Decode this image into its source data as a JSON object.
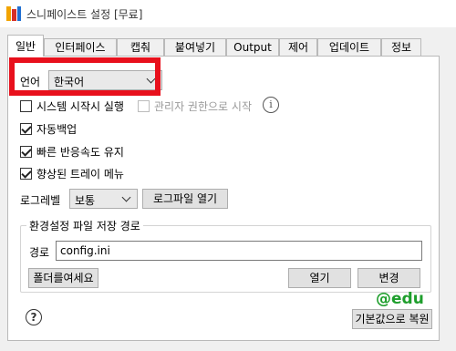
{
  "window": {
    "title": "스니페이스트 설정 [무료]"
  },
  "tabs": [
    "일반",
    "인터페이스",
    "캡춰",
    "붙여넣기",
    "Output",
    "제어",
    "업데이트",
    "정보"
  ],
  "language": {
    "label": "언어",
    "value": "한국어"
  },
  "options": {
    "startup": "시스템 시작시 실행",
    "admin": "관리자 권한으로 시작",
    "autobackup": "자동백업",
    "fast_response": "빠른 반응속도 유지",
    "tray_menu": "향상된 트레이 메뉴"
  },
  "option_states": {
    "startup": false,
    "admin": false,
    "autobackup": true,
    "fast_response": true,
    "tray_menu": true
  },
  "log": {
    "label": "로그레벨",
    "value": "보통",
    "open_button": "로그파일 열기"
  },
  "config": {
    "group_title": "환경설정 파일 저장 경로",
    "path_label": "경로",
    "path_value": "config.ini",
    "open_folder_button": "폴더를여세요",
    "open_button": "열기",
    "change_button": "변경"
  },
  "footer": {
    "reset_button": "기본값으로 복원"
  },
  "watermark": "@edu",
  "colors": {
    "highlight": "#e8101c",
    "watermark": "#1e9e2c"
  },
  "icons": {
    "info": "info-icon",
    "help": "help-icon"
  }
}
